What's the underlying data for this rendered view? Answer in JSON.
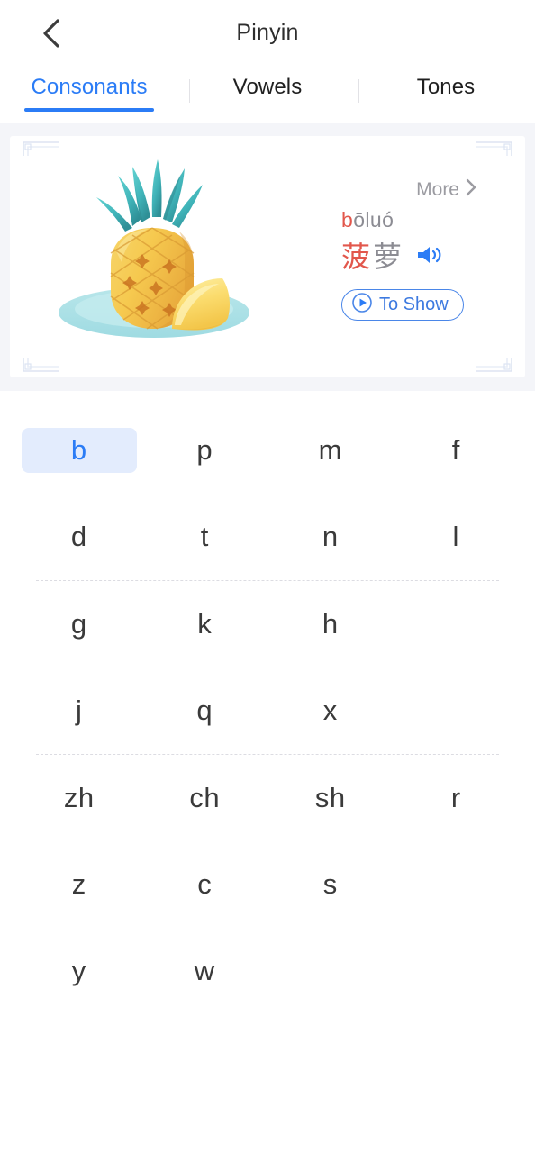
{
  "header": {
    "title": "Pinyin",
    "back_icon": "chevron-left-icon"
  },
  "tabs": [
    {
      "label": "Consonants",
      "active": true
    },
    {
      "label": "Vowels",
      "active": false
    },
    {
      "label": "Tones",
      "active": false
    }
  ],
  "card": {
    "more_label": "More",
    "more_icon": "chevron-right-icon",
    "pinyin_highlight": "b",
    "pinyin_rest": "ōluó",
    "hanzi_highlight": "菠",
    "hanzi_rest": "萝",
    "speaker_icon": "speaker-icon",
    "play_icon": "play-circle-icon",
    "to_show_label": "To Show",
    "illustration": "pineapple-on-plate-illustration",
    "corner_ornament": "corner-ornament-icon"
  },
  "grid": {
    "groups": [
      {
        "rows": [
          [
            "b",
            "p",
            "m",
            "f"
          ],
          [
            "d",
            "t",
            "n",
            "l"
          ]
        ]
      },
      {
        "rows": [
          [
            "g",
            "k",
            "h",
            ""
          ],
          [
            "j",
            "q",
            "x",
            ""
          ]
        ]
      },
      {
        "rows": [
          [
            "zh",
            "ch",
            "sh",
            "r"
          ],
          [
            "z",
            "c",
            "s",
            ""
          ],
          [
            "y",
            "w",
            "",
            ""
          ]
        ]
      }
    ],
    "selected": "b"
  },
  "colors": {
    "accent": "#2b7cf6",
    "selected_bg": "#e3ecfd",
    "highlight_red": "#e2574c",
    "muted_gray": "#8c8c93",
    "band_bg": "#f4f5f9"
  }
}
